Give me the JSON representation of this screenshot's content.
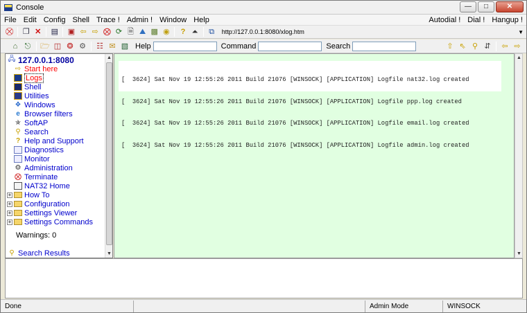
{
  "window": {
    "title": "Console"
  },
  "menubar": {
    "left": [
      "File",
      "Edit",
      "Config",
      "Shell",
      "Trace !",
      "Admin !",
      "Window",
      "Help"
    ],
    "right": [
      "Autodial !",
      "Dial !",
      "Hangup !"
    ]
  },
  "toolbar1": {
    "url": "http://127.0.0.1:8080/xlog.htm"
  },
  "toolbar2": {
    "help_label": "Help",
    "command_label": "Command",
    "search_label": "Search"
  },
  "tree": {
    "root": "127.0.0.1:8080",
    "items": [
      {
        "label": "Start here",
        "icon": "arrow-right-icon"
      },
      {
        "label": "Logs",
        "icon": "logs-icon"
      },
      {
        "label": "Shell",
        "icon": "shell-icon"
      },
      {
        "label": "Utilities",
        "icon": "utilities-icon"
      },
      {
        "label": "Windows",
        "icon": "windows-icon"
      },
      {
        "label": "Browser filters",
        "icon": "browser-icon"
      },
      {
        "label": "SoftAP",
        "icon": "antenna-icon"
      },
      {
        "label": "Search",
        "icon": "magnifier-icon"
      },
      {
        "label": "Help and Support",
        "icon": "help-icon"
      },
      {
        "label": "Diagnostics",
        "icon": "page-icon"
      },
      {
        "label": "Monitor",
        "icon": "page-icon"
      },
      {
        "label": "Administration",
        "icon": "admin-icon"
      },
      {
        "label": "Terminate",
        "icon": "stop-icon"
      },
      {
        "label": "NAT32 Home",
        "icon": "home-page-icon"
      }
    ],
    "folders": [
      "How To",
      "Configuration",
      "Settings Viewer",
      "Settings Commands"
    ],
    "warnings": "Warnings: 0",
    "search_results": "Search Results"
  },
  "log": {
    "lines": [
      "[  3624] Sat Nov 19 12:55:26 2011 Build 21076 [WINSOCK] [APPLICATION] Logfile nat32.log created",
      "[  3624] Sat Nov 19 12:55:26 2011 Build 21076 [WINSOCK] [APPLICATION] Logfile ppp.log created",
      "[  3624] Sat Nov 19 12:55:26 2011 Build 21076 [WINSOCK] [APPLICATION] Logfile email.log created",
      "[  3624] Sat Nov 19 12:55:26 2011 Build 21076 [WINSOCK] [APPLICATION] Logfile admin.log created"
    ]
  },
  "status": {
    "left": "Done",
    "mode": "Admin Mode",
    "net": "WINSOCK"
  },
  "colors": {
    "content_bg": "#e1ffe1",
    "link": "#0000cc",
    "active_link": "#ff0000"
  }
}
